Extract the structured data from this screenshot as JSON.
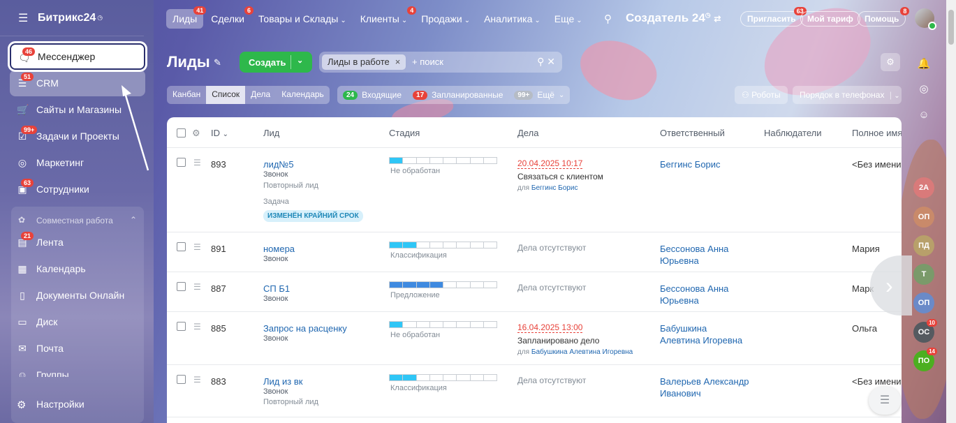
{
  "sidebar": {
    "brand": "Битрикс24",
    "items": [
      {
        "label": "Мессенджер",
        "badge": "46"
      },
      {
        "label": "CRM",
        "badge": "51"
      },
      {
        "label": "Сайты и Магазины",
        "badge": ""
      },
      {
        "label": "Задачи и Проекты",
        "badge": "99+"
      },
      {
        "label": "Маркетинг",
        "badge": ""
      },
      {
        "label": "Сотрудники",
        "badge": "63"
      }
    ],
    "group_title": "Совместная работа",
    "group_items": [
      {
        "label": "Лента",
        "badge": "21"
      },
      {
        "label": "Календарь",
        "badge": ""
      },
      {
        "label": "Документы Онлайн",
        "badge": ""
      },
      {
        "label": "Диск",
        "badge": ""
      },
      {
        "label": "Почта",
        "badge": ""
      },
      {
        "label": "Группы",
        "badge": ""
      }
    ],
    "settings": "Настройки"
  },
  "topnav": {
    "items": [
      {
        "label": "Лиды",
        "badge": "41"
      },
      {
        "label": "Сделки",
        "badge": "6"
      },
      {
        "label": "Товары и Склады",
        "badge": ""
      },
      {
        "label": "Клиенты",
        "badge": "4"
      },
      {
        "label": "Продажи",
        "badge": ""
      },
      {
        "label": "Аналитика",
        "badge": ""
      },
      {
        "label": "Еще",
        "badge": ""
      }
    ],
    "creator": "Создатель 24",
    "invite": "Пригласить",
    "invite_badge": "63",
    "tariff": "Мой тариф",
    "help": "Помощь",
    "help_badge": "8"
  },
  "page": {
    "title": "Лиды",
    "create": "Создать",
    "filter_tag": "Лиды в работе",
    "search_placeholder": "+ поиск",
    "views": [
      "Канбан",
      "Список",
      "Дела",
      "Календарь"
    ],
    "counters": [
      {
        "count": "24",
        "label": "Входящие",
        "color": "#2eb84b"
      },
      {
        "count": "17",
        "label": "Запланированные",
        "color": "#e8423a"
      },
      {
        "count": "99+",
        "label": "Ещё",
        "color": "#b6bcc5"
      }
    ],
    "robots": "Роботы",
    "order": "Порядок в телефонах"
  },
  "table": {
    "headers": [
      "ID",
      "Лид",
      "Стадия",
      "Дела",
      "Ответственный",
      "Наблюдатели",
      "Полное имя"
    ],
    "rows": [
      {
        "id": "893",
        "name": "лид№5",
        "source": "Звонок",
        "extra": "Повторный лид",
        "task": "Задача",
        "tag": "ИЗМЕНЁН КРАЙНИЙ СРОК",
        "stage": "Не обработан",
        "stage_fill": 1,
        "stage_color": "#2fc6f6",
        "deal_date": "20.04.2025 10:17",
        "deal_text": "Связаться с клиентом",
        "deal_for_prefix": "для",
        "deal_for": "Беггинс Борис",
        "resp1": "Беггинс Борис",
        "resp2": "",
        "fullname": "<Без имени"
      },
      {
        "id": "891",
        "name": "номера",
        "source": "Звонок",
        "extra": "",
        "task": "",
        "tag": "",
        "stage": "Классификация",
        "stage_fill": 2,
        "stage_color": "#2fc6f6",
        "deal_date": "",
        "deal_text": "Дела отсутствуют",
        "deal_for_prefix": "",
        "deal_for": "",
        "resp1": "Бессонова Анна",
        "resp2": "Юрьевна",
        "fullname": "Мария"
      },
      {
        "id": "887",
        "name": "СП Б1",
        "source": "Звонок",
        "extra": "",
        "task": "",
        "tag": "",
        "stage": "Предложение",
        "stage_fill": 4,
        "stage_color": "#3f8ae0",
        "deal_date": "",
        "deal_text": "Дела отсутствуют",
        "deal_for_prefix": "",
        "deal_for": "",
        "resp1": "Бессонова Анна",
        "resp2": "Юрьевна",
        "fullname": "Марк"
      },
      {
        "id": "885",
        "name": "Запрос на расценку",
        "source": "Звонок",
        "extra": "",
        "task": "",
        "tag": "",
        "stage": "Не обработан",
        "stage_fill": 1,
        "stage_color": "#2fc6f6",
        "deal_date": "16.04.2025 13:00",
        "deal_text": "Запланировано дело",
        "deal_for_prefix": "для",
        "deal_for": "Бабушкина Алевтина Игоревна",
        "resp1": "Бабушкина",
        "resp2": "Алевтина Игоревна",
        "fullname": "Ольга"
      },
      {
        "id": "883",
        "name": "Лид из вк",
        "source": "Звонок",
        "extra": "Повторный лид",
        "task": "",
        "tag": "",
        "stage": "Классификация",
        "stage_fill": 2,
        "stage_color": "#2fc6f6",
        "deal_date": "",
        "deal_text": "Дела отсутствуют",
        "deal_for_prefix": "",
        "deal_for": "",
        "resp1": "Валерьев Александр",
        "resp2": "Иванович",
        "fullname": "<Без имени"
      }
    ]
  },
  "rightpanel": {
    "avatars": [
      {
        "label": "2А",
        "color": "#d97a7a",
        "badge": ""
      },
      {
        "label": "ОП",
        "color": "#c98a6a",
        "badge": ""
      },
      {
        "label": "ПД",
        "color": "#b8a06a",
        "badge": ""
      },
      {
        "label": "Т",
        "color": "#7a9a6a",
        "badge": ""
      },
      {
        "label": "ОП",
        "color": "#6a8ac8",
        "badge": ""
      },
      {
        "label": "ОС",
        "color": "#555a60",
        "badge": "10"
      },
      {
        "label": "ПО",
        "color": "#4caf20",
        "badge": "14"
      }
    ]
  }
}
